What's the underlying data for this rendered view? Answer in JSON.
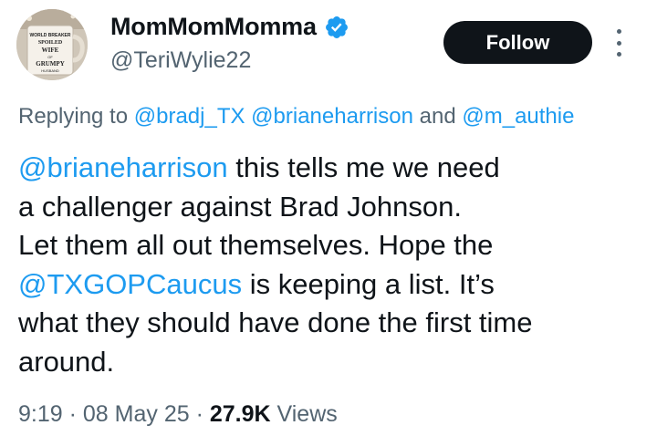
{
  "author": {
    "display_name": "MomMomMomma",
    "handle": "@TeriWylie22",
    "avatar_mug_text": [
      "WORLD BREAKER",
      "SPOILED",
      "WIFE",
      "OF",
      "GRUMPY",
      "HUSBAND"
    ]
  },
  "follow_label": "Follow",
  "replying": {
    "prefix": "Replying to",
    "mention_1": "@bradj_TX",
    "mention_2": "@brianeharrison",
    "separator": "and",
    "mention_3": "@m_authie"
  },
  "tweet": {
    "line_1_mention": "@brianeharrison",
    "line_1_text": " this tells me we need",
    "line_2": "a challenger against Brad Johnson.",
    "line_3": "Let them all out themselves. Hope the",
    "line_4_mention": "@TXGOPCaucus",
    "line_4_text": " is keeping a list. It’s",
    "line_5": "what they should have done the first time",
    "line_6": "around."
  },
  "meta": {
    "time": "9:19",
    "sep_1": " · ",
    "date": "08 May 25",
    "sep_2": " · ",
    "views_count": "27.9K",
    "views_label": " Views"
  },
  "colors": {
    "link": "#1d9bf0",
    "secondary_text": "#536471",
    "primary_text": "#0f1419",
    "follow_bg": "#0f1419",
    "verified": "#1d9bf0"
  },
  "icons": {
    "verified": "verified-badge-icon",
    "more": "more-options-icon"
  }
}
